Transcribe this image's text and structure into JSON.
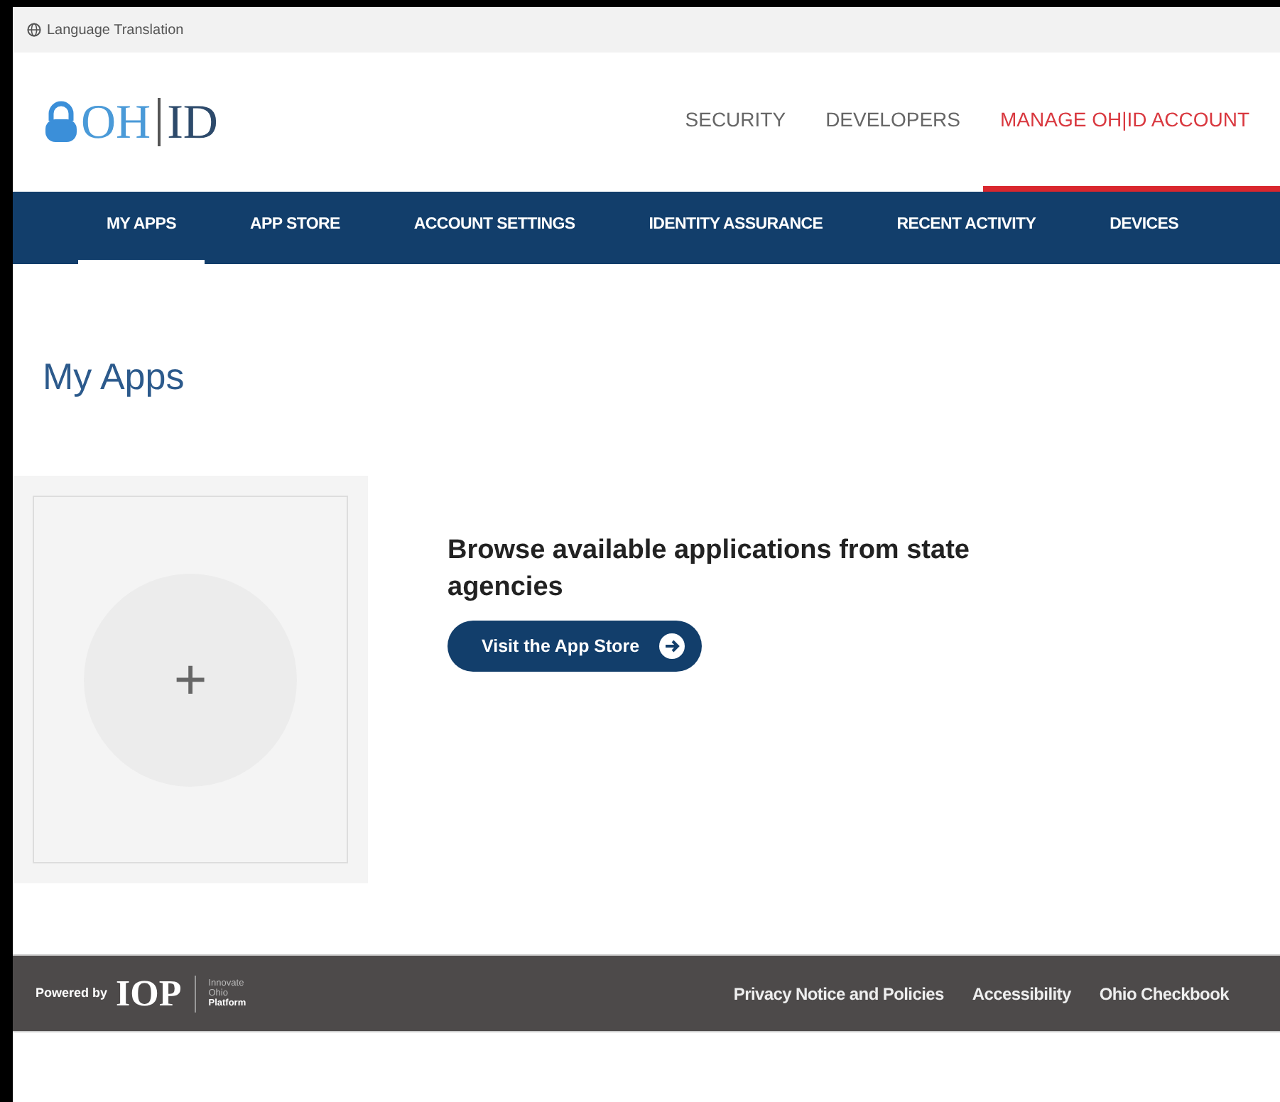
{
  "language_bar": {
    "label": "Language Translation"
  },
  "logo": {
    "left": "OH",
    "right": "ID"
  },
  "top_nav": [
    {
      "label": "SECURITY",
      "selected": false
    },
    {
      "label": "DEVELOPERS",
      "selected": false
    },
    {
      "label": "MANAGE OH|ID ACCOUNT",
      "selected": true
    }
  ],
  "tabs": [
    {
      "label": "MY APPS",
      "selected": true
    },
    {
      "label": "APP STORE",
      "selected": false
    },
    {
      "label": "ACCOUNT SETTINGS",
      "selected": false
    },
    {
      "label": "IDENTITY ASSURANCE",
      "selected": false
    },
    {
      "label": "RECENT ACTIVITY",
      "selected": false
    },
    {
      "label": "DEVICES",
      "selected": false
    }
  ],
  "page_title": "My Apps",
  "add_tile": {
    "symbol": "+"
  },
  "promo": {
    "heading": "Browse available applications from state agencies",
    "button": "Visit the App Store"
  },
  "footer": {
    "powered_by": "Powered by",
    "brand": "IOP",
    "brand_lines": [
      "Innovate",
      "Ohio",
      "Platform"
    ],
    "links": [
      "Privacy Notice and Policies",
      "Accessibility",
      "Ohio Checkbook"
    ]
  }
}
